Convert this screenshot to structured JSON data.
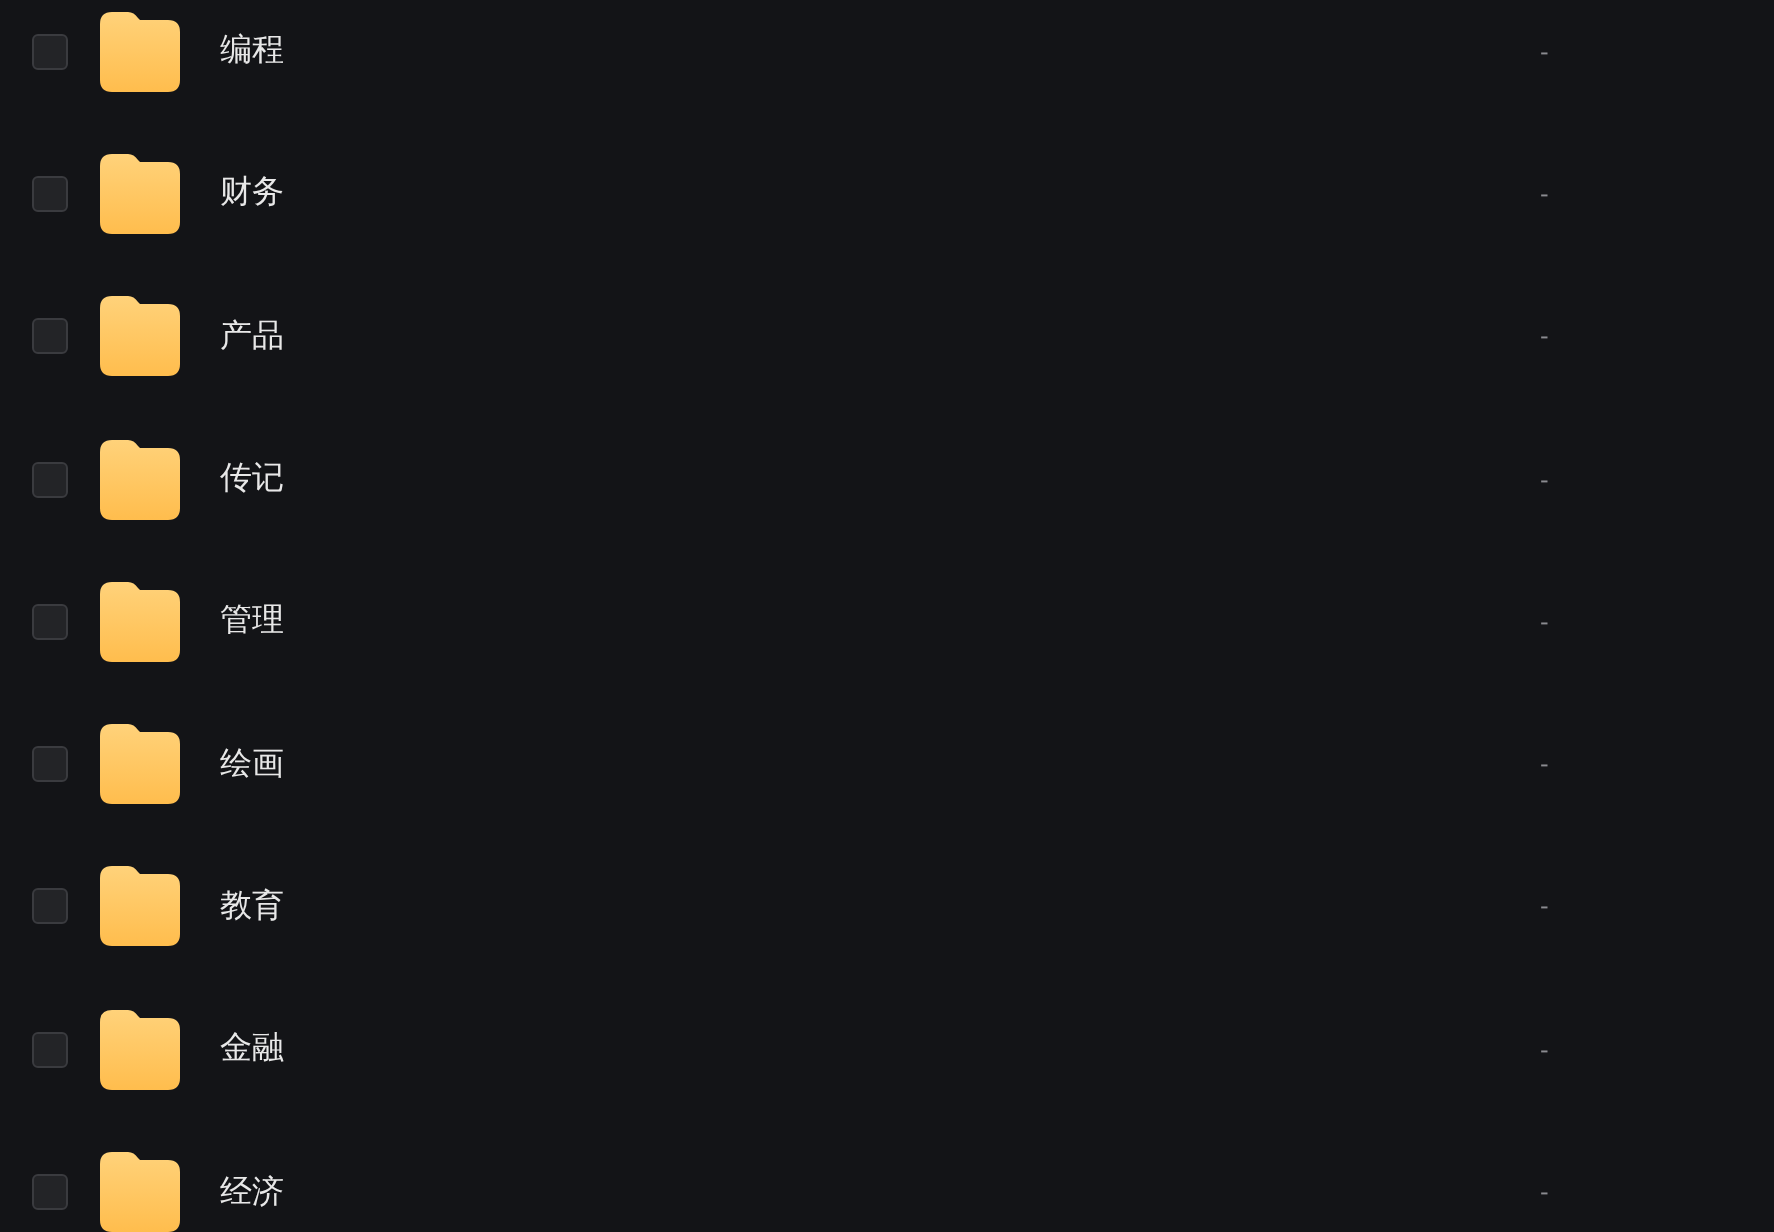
{
  "files": [
    {
      "name": "编程",
      "checked": false,
      "size": "-"
    },
    {
      "name": "财务",
      "checked": false,
      "size": "-"
    },
    {
      "name": "产品",
      "checked": false,
      "size": "-"
    },
    {
      "name": "传记",
      "checked": false,
      "size": "-"
    },
    {
      "name": "管理",
      "checked": false,
      "size": "-"
    },
    {
      "name": "绘画",
      "checked": false,
      "size": "-"
    },
    {
      "name": "教育",
      "checked": false,
      "size": "-"
    },
    {
      "name": "金融",
      "checked": false,
      "size": "-"
    },
    {
      "name": "经济",
      "checked": false,
      "size": "-"
    }
  ]
}
